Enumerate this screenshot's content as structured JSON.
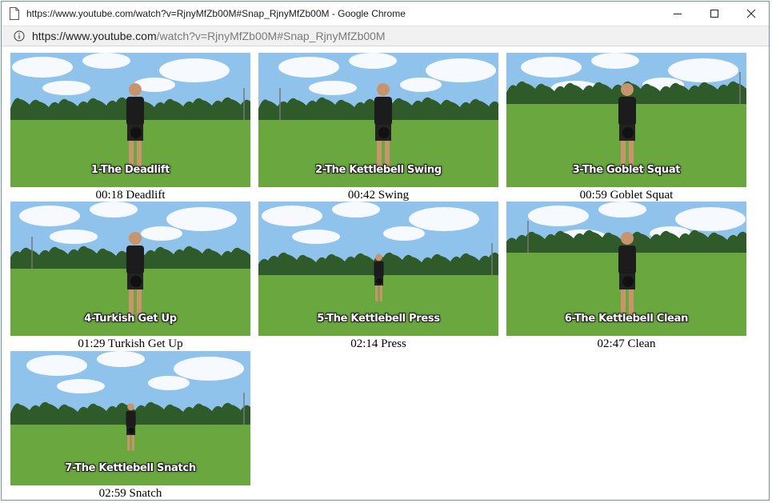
{
  "window": {
    "title": "https://www.youtube.com/watch?v=RjnyMfZb00M#Snap_RjnyMfZb00M - Google Chrome",
    "icons": {
      "page": "document-icon",
      "minimize": "minimize-icon",
      "maximize": "maximize-icon",
      "close": "close-icon"
    }
  },
  "address_bar": {
    "url_host": "https://www.youtube.com",
    "url_path": "/watch?v=RjnyMfZb00M#Snap_RjnyMfZb00M",
    "icon": "info-icon"
  },
  "clips": [
    {
      "overlay": "1-The Deadlift",
      "caption": "00:18 Deadlift",
      "scene": "close"
    },
    {
      "overlay": "2-The Kettlebell Swing",
      "caption": "00:42 Swing",
      "scene": "close"
    },
    {
      "overlay": "3-The Goblet Squat",
      "caption": "00:59 Goblet Squat",
      "scene": "far"
    },
    {
      "overlay": "4-Turkish Get Up",
      "caption": "01:29 Turkish Get Up",
      "scene": "close"
    },
    {
      "overlay": "5-The Kettlebell Press",
      "caption": "02:14 Press",
      "scene": "mid"
    },
    {
      "overlay": "6-The Kettlebell Clean",
      "caption": "02:47 Clean",
      "scene": "far"
    },
    {
      "overlay": "7-The Kettlebell Snatch",
      "caption": "02:59 Snatch",
      "scene": "mid"
    }
  ],
  "colors": {
    "sky": "#8fc3ec",
    "cloud": "#ffffff",
    "trees": "#2f5a2a",
    "grass": "#6aa83f",
    "window_border": "#6b8fb8"
  }
}
